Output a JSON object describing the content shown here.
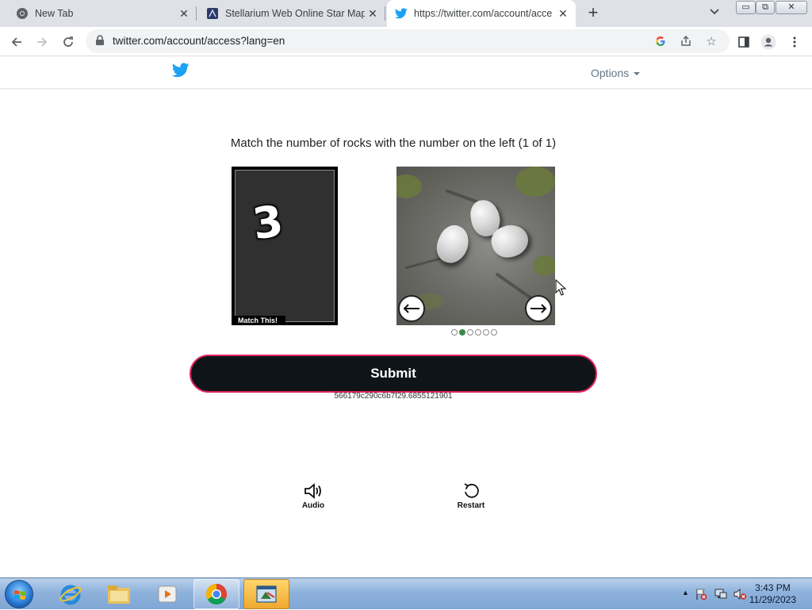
{
  "browser": {
    "tabs": [
      {
        "title": "New Tab",
        "icon": "chrome-icon",
        "active": false
      },
      {
        "title": "Stellarium Web Online Star Map",
        "icon": "stellarium-icon",
        "active": false
      },
      {
        "title": "https://twitter.com/account/acce",
        "icon": "twitter-icon",
        "active": true
      }
    ],
    "url": "twitter.com/account/access?lang=en",
    "minimize_label": "▭",
    "restore_label": "⧉",
    "close_label": "✕"
  },
  "header": {
    "options_label": "Options"
  },
  "captcha": {
    "instruction": "Match the number of rocks with the number on the left (1 of 1)",
    "target_number": "3",
    "match_label": "Match This!",
    "image_count": 6,
    "selected_image": 2,
    "submit_label": "Submit",
    "session_id": "566179c290c6b7f29.6855121901"
  },
  "tools": {
    "audio_label": "Audio",
    "restart_label": "Restart"
  },
  "taskbar": {
    "apps": [
      "internet-explorer",
      "file-explorer",
      "media-player",
      "chrome",
      "app-highlighted"
    ],
    "time": "3:43 PM",
    "date": "11/29/2023"
  },
  "colors": {
    "twitter_blue": "#1da1f2",
    "submit_bg": "#0f1419",
    "submit_border": "#e0245e",
    "active_dot": "#3c8a4a"
  }
}
